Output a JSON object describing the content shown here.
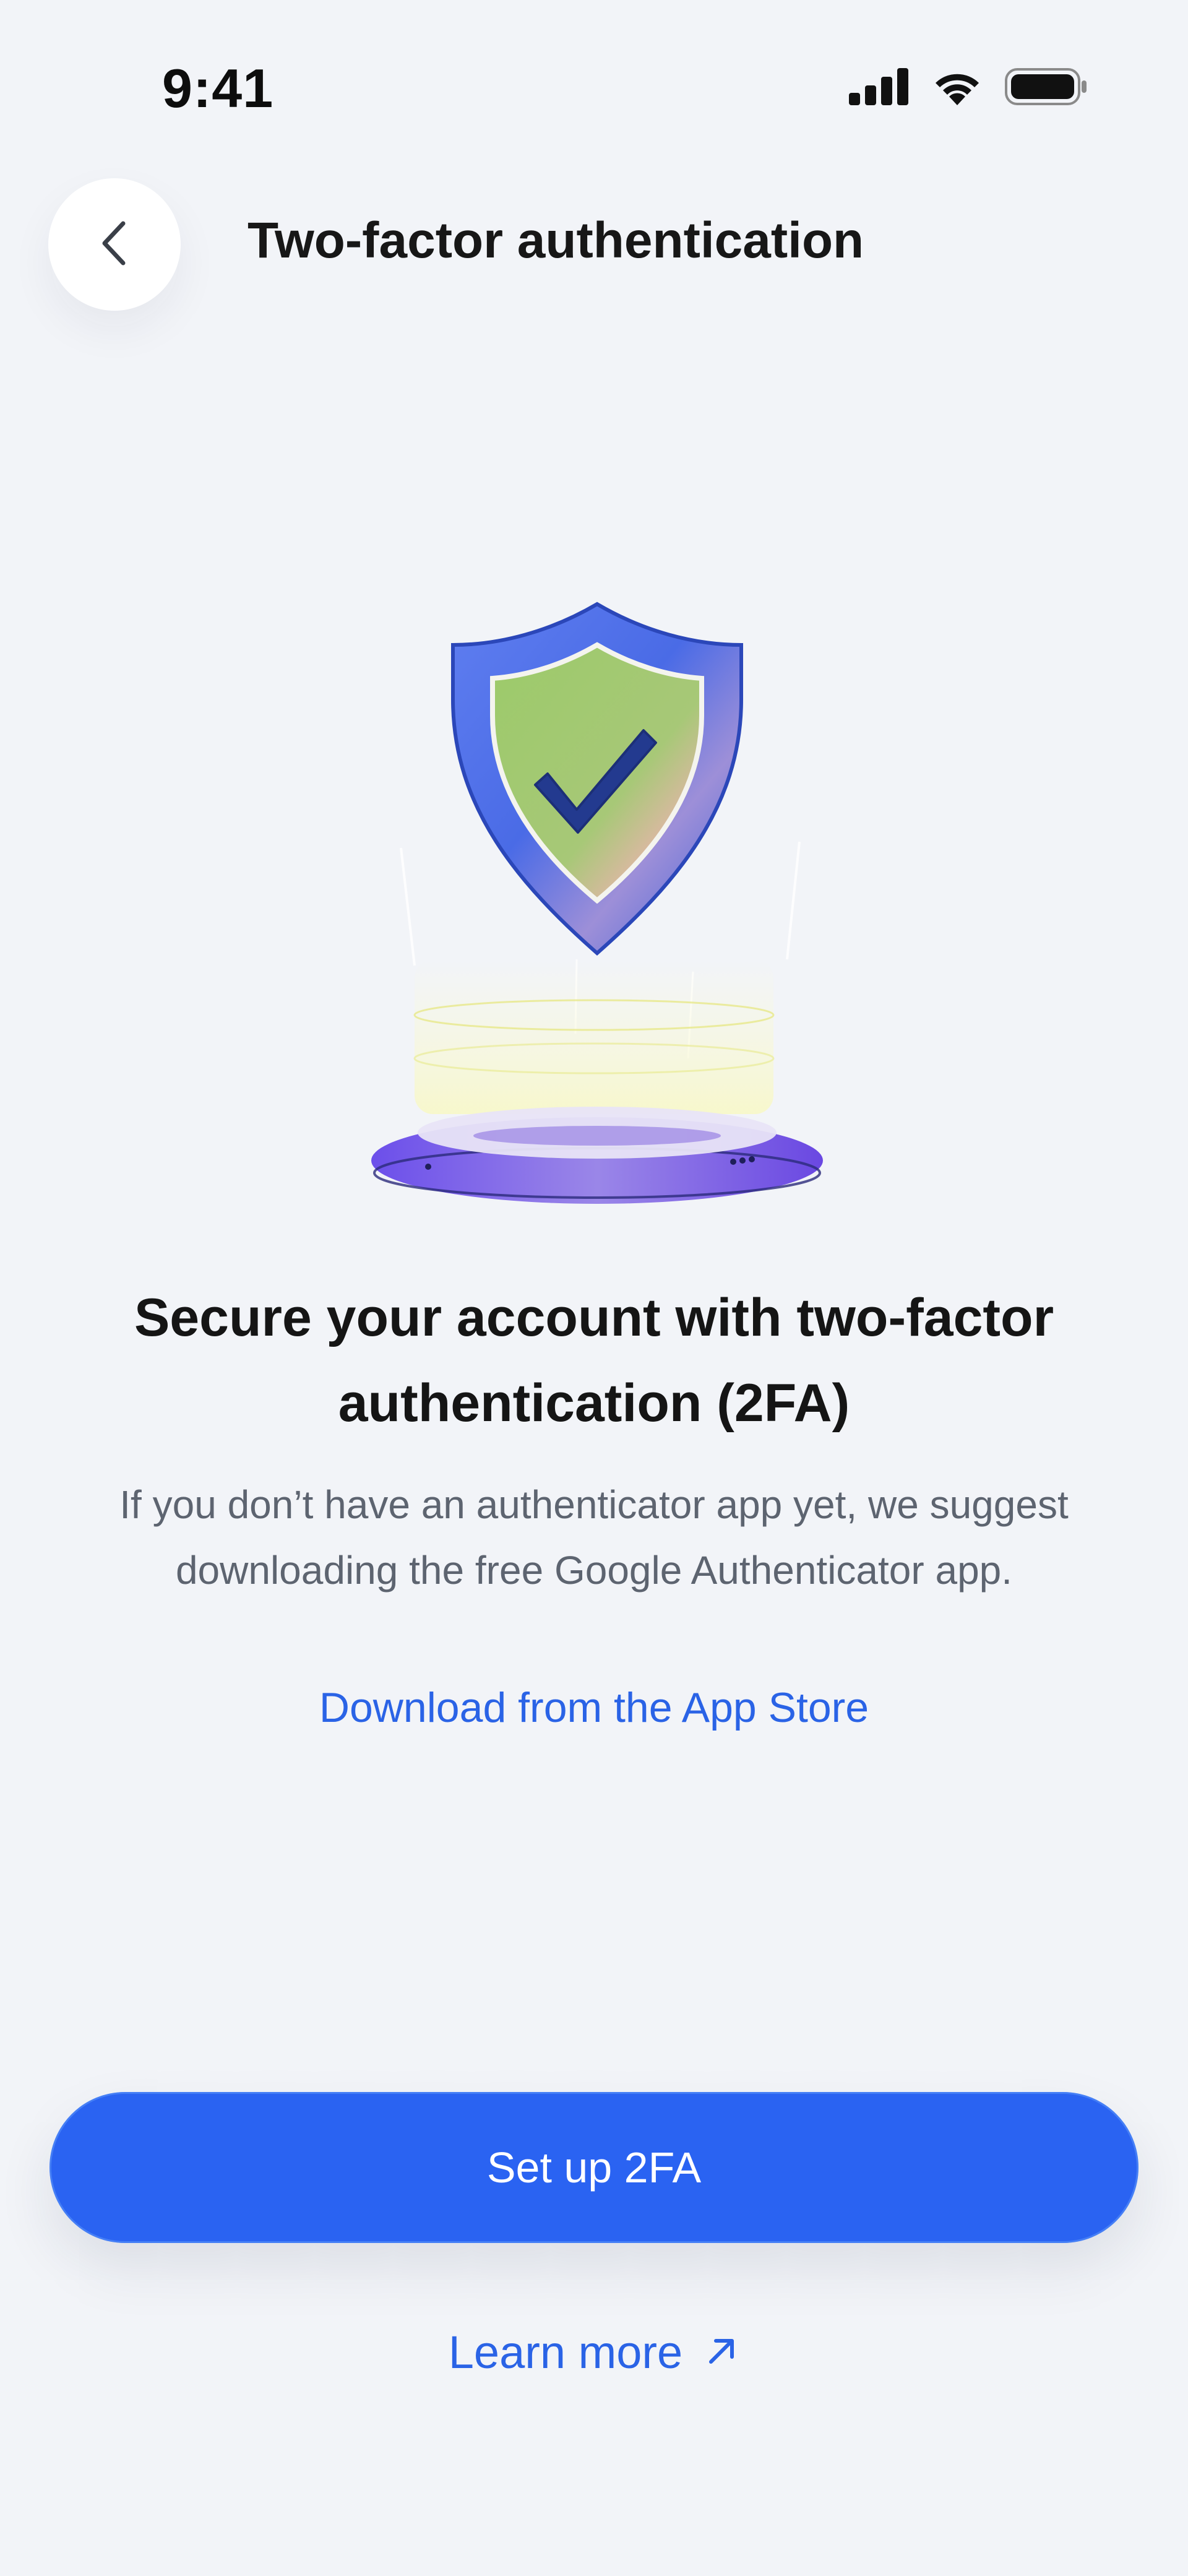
{
  "status_bar": {
    "time": "9:41",
    "icons": [
      "signal-icon",
      "wifi-icon",
      "battery-icon"
    ]
  },
  "header": {
    "back_icon": "chevron-left-icon",
    "title": "Two-factor authentication"
  },
  "illustration": {
    "subject": "shield-checkmark-icon"
  },
  "content": {
    "headline": "Secure your account with two-factor authentication (2FA)",
    "description": "If you don’t have an authenticator app yet, we suggest downloading the free Google Authenticator app.",
    "store_link": "Download from the App Store"
  },
  "actions": {
    "primary_label": "Set up 2FA",
    "secondary_label": "Learn more",
    "secondary_icon": "arrow-up-right-icon"
  },
  "colors": {
    "background": "#f2f4f8",
    "accent": "#2a63f2",
    "link": "#2a63e6",
    "text_primary": "#151515",
    "text_secondary": "#5d6470"
  }
}
